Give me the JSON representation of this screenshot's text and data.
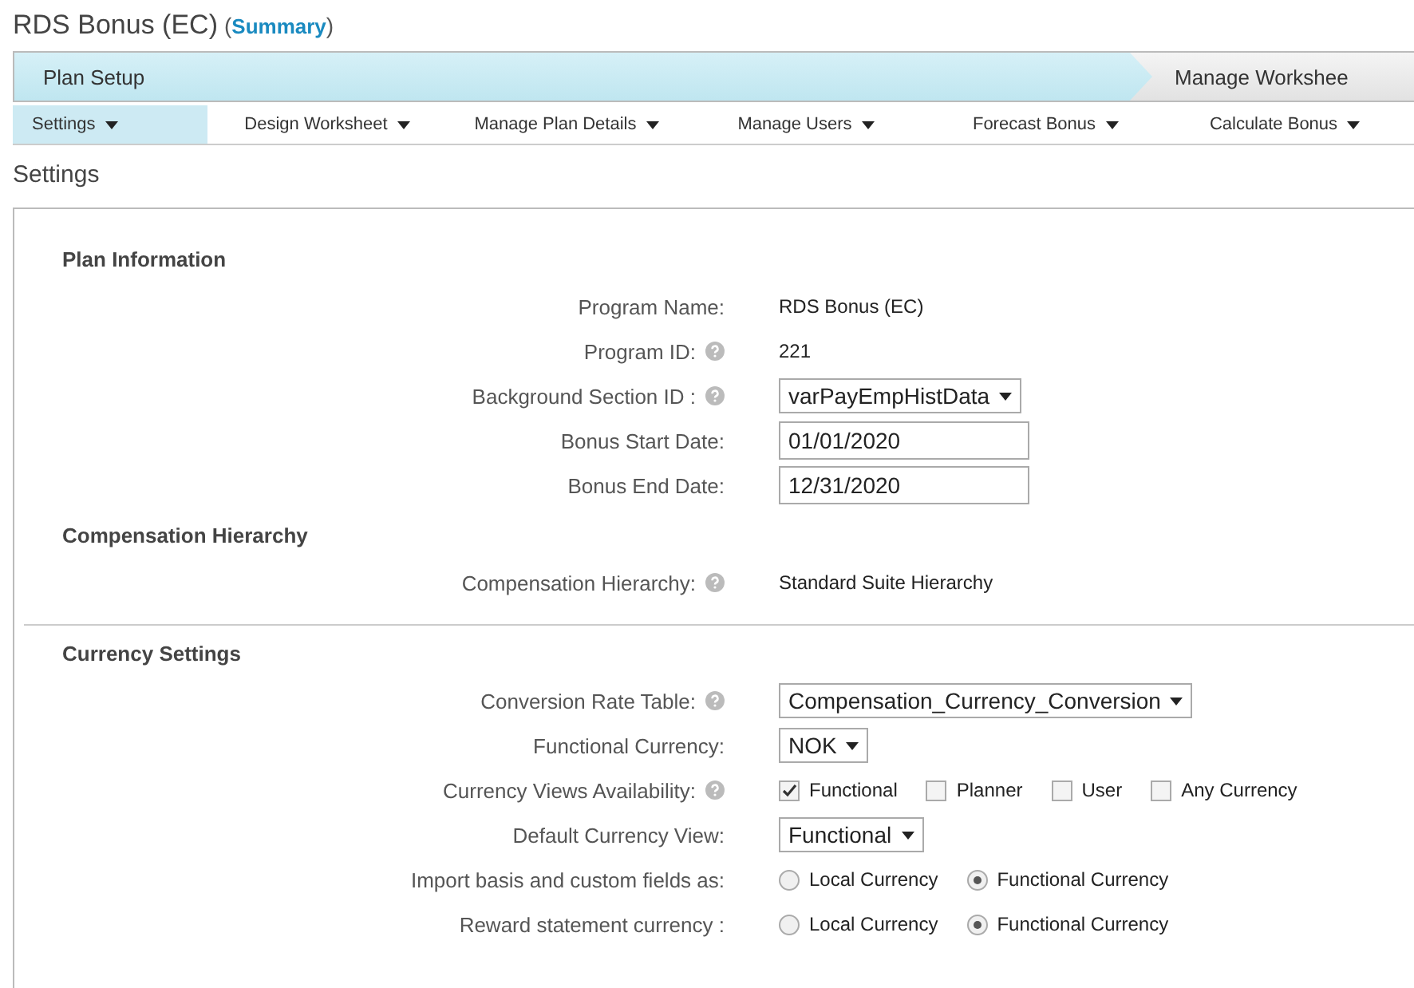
{
  "page_title": "RDS Bonus (EC)",
  "summary_open": "(",
  "summary_link": "Summary",
  "summary_close": ")",
  "stages": [
    {
      "label": "Plan Setup",
      "selected": true
    },
    {
      "label": "Manage Workshee",
      "selected": false
    }
  ],
  "menu_tabs": [
    {
      "label": "Settings",
      "selected": true
    },
    {
      "label": "Design Worksheet",
      "selected": false
    },
    {
      "label": "Manage Plan Details",
      "selected": false
    },
    {
      "label": "Manage Users",
      "selected": false
    },
    {
      "label": "Forecast Bonus",
      "selected": false
    },
    {
      "label": "Calculate Bonus",
      "selected": false
    }
  ],
  "heading": "Settings",
  "sections": [
    {
      "title": "Plan Information",
      "divider_before": false,
      "rows": [
        {
          "kind": "text",
          "label": "Program Name:",
          "help": false,
          "value": "RDS Bonus (EC)"
        },
        {
          "kind": "text",
          "label": "Program ID:",
          "help": true,
          "value": "221"
        },
        {
          "kind": "select",
          "label": "Background Section ID :",
          "help": true,
          "value": "varPayEmpHistData"
        },
        {
          "kind": "input",
          "label": "Bonus Start Date:",
          "help": false,
          "value": "01/01/2020"
        },
        {
          "kind": "input",
          "label": "Bonus End Date:",
          "help": false,
          "value": "12/31/2020"
        }
      ]
    },
    {
      "title": "Compensation Hierarchy",
      "divider_before": false,
      "rows": [
        {
          "kind": "text",
          "label": "Compensation Hierarchy:",
          "help": true,
          "value": "Standard Suite Hierarchy"
        }
      ]
    },
    {
      "title": "Currency Settings",
      "divider_before": true,
      "rows": [
        {
          "kind": "select",
          "label": "Conversion Rate Table:",
          "help": true,
          "value": "Compensation_Currency_Conversion"
        },
        {
          "kind": "select",
          "label": "Functional Currency:",
          "help": false,
          "value": "NOK"
        },
        {
          "kind": "checks",
          "label": "Currency Views Availability:",
          "help": true,
          "options": [
            {
              "label": "Functional",
              "checked": true
            },
            {
              "label": "Planner",
              "checked": false
            },
            {
              "label": "User",
              "checked": false
            },
            {
              "label": "Any Currency",
              "checked": false
            }
          ]
        },
        {
          "kind": "select",
          "label": "Default Currency View:",
          "help": false,
          "value": "Functional"
        },
        {
          "kind": "radios",
          "label": "Import basis and custom fields as:",
          "help": false,
          "options": [
            {
              "label": "Local Currency",
              "selected": false
            },
            {
              "label": "Functional Currency",
              "selected": true
            }
          ]
        },
        {
          "kind": "radios",
          "label": "Reward statement currency :",
          "help": false,
          "options": [
            {
              "label": "Local Currency",
              "selected": false
            },
            {
              "label": "Functional Currency",
              "selected": true
            }
          ]
        }
      ]
    }
  ]
}
